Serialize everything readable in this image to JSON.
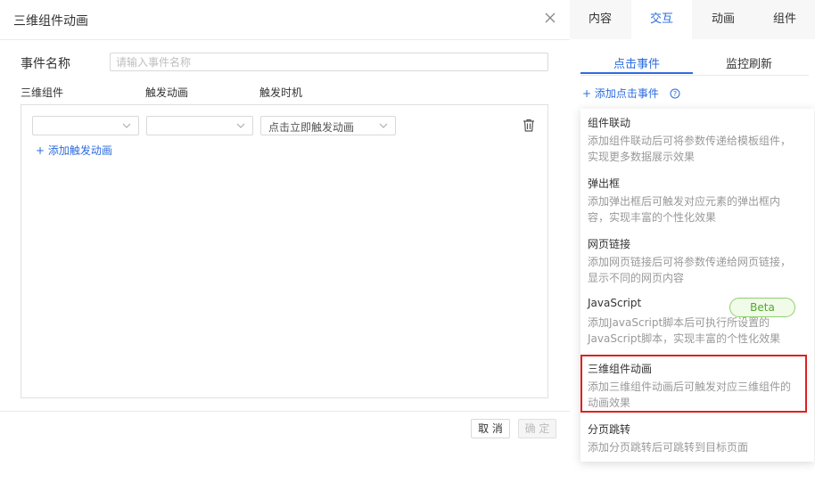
{
  "modal": {
    "title": "三维组件动画",
    "name_label": "事件名称",
    "name_placeholder": "请输入事件名称",
    "columns": [
      "三维组件",
      "触发动画",
      "触发时机"
    ],
    "trigger_row": {
      "component_value": "",
      "animation_value": "",
      "timing_value": "点击立即触发动画"
    },
    "add_trigger_label": "+ 添加触发动画",
    "cancel_label": "取 消",
    "ok_label": "确 定"
  },
  "right_panel": {
    "tabs": [
      "内容",
      "交互",
      "动画",
      "组件"
    ],
    "active_tab": "交互",
    "sub_tabs": [
      "点击事件",
      "监控刷新"
    ],
    "active_sub_tab": "点击事件",
    "add_event_label": "+ 添加点击事件",
    "menu": [
      {
        "title": "组件联动",
        "desc": "添加组件联动后可将参数传递给模板组件，实现更多数据展示效果"
      },
      {
        "title": "弹出框",
        "desc": "添加弹出框后可触发对应元素的弹出框内容，实现丰富的个性化效果"
      },
      {
        "title": "网页链接",
        "desc": "添加网页链接后可将参数传递给网页链接，显示不同的网页内容"
      },
      {
        "title": "JavaScript",
        "desc": "添加JavaScript脚本后可执行所设置的JavaScript脚本，实现丰富的个性化效果",
        "badge": "Beta"
      },
      {
        "title": "三维组件动画",
        "desc": "添加三维组件动画后可触发对应三维组件的动画效果",
        "selected": true
      },
      {
        "title": "分页跳转",
        "desc": "添加分页跳转后可跳转到目标页面"
      }
    ]
  },
  "colors": {
    "accent": "#2d6cdf",
    "highlight": "#e02020",
    "beta_green": "#52a82e"
  }
}
